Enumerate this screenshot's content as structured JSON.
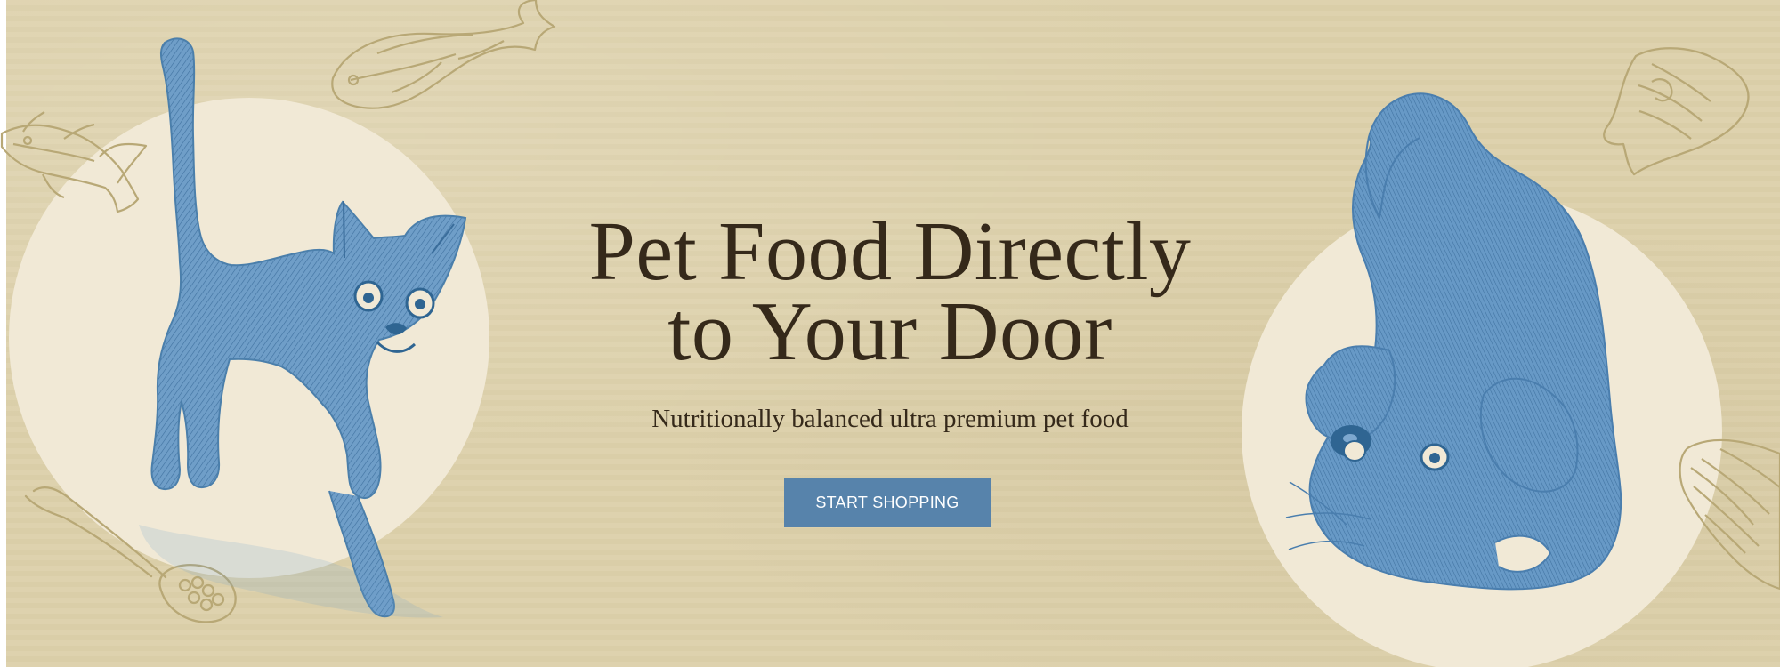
{
  "hero": {
    "title_line_1": "Pet Food Directly",
    "title_line_2": "to Your Door",
    "subtitle": "Nutritionally balanced ultra premium pet food",
    "cta_label": "START SHOPPING"
  },
  "icons": [
    "tuna-fish-icon",
    "sea-bream-fish-icon",
    "cat-illustration",
    "spoon-with-kibble-icon",
    "salmon-steak-icon",
    "salmon-fillet-icon",
    "puppy-illustration"
  ],
  "colors": {
    "background": "#ddd1ab",
    "circle": "#f1e9d6",
    "animal_blue": "#5b8ebe",
    "food_line_art": "#b8a876",
    "headline_text": "#35291a",
    "button_background": "#5783ab",
    "button_text": "#ffffff"
  }
}
